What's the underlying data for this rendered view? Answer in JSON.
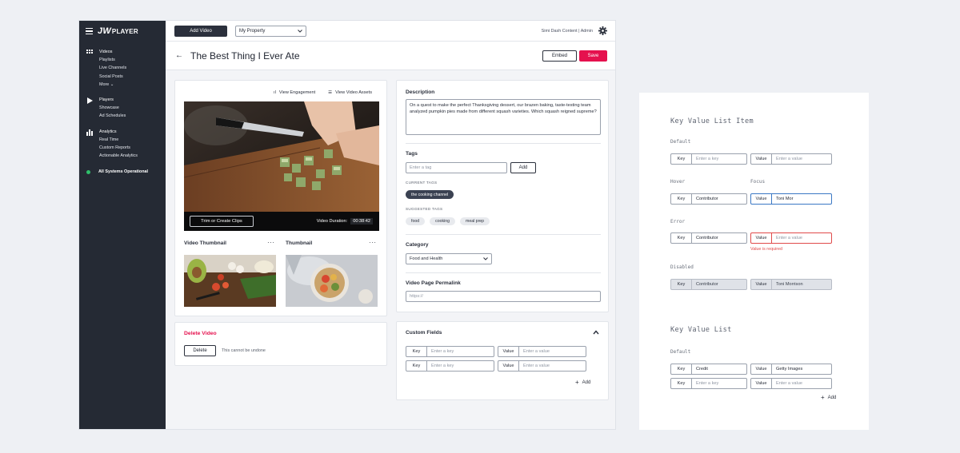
{
  "sidebar": {
    "logo": "PLAYER",
    "groups": [
      {
        "items": [
          "Videos",
          "Playlists",
          "Live Channels",
          "Social Posts",
          "More ⌄"
        ]
      },
      {
        "items": [
          "Players",
          "Showcase",
          "Ad Schedules"
        ]
      },
      {
        "items": [
          "Analytics",
          "Real Time",
          "Custom Reports",
          "Actionable Analytics"
        ]
      }
    ],
    "status": "All Systems Operational"
  },
  "topbar": {
    "add_video": "Add Video",
    "property": "My Property",
    "user": "Simi Dash Content | Admin"
  },
  "titlebar": {
    "title": "The Best Thing I Ever Ate",
    "embed": "Embed",
    "save": "Save"
  },
  "media": {
    "view_engagement": "View Engagement",
    "view_assets": "View Video Assets",
    "trim": "Trim or Create Clips",
    "duration_label": "Video Duration:",
    "duration_value": "00:38:42",
    "video_thumb_label": "Video Thumbnail",
    "thumb_label": "Thumbnail",
    "dots": "···"
  },
  "delete": {
    "title": "Delete Video",
    "button": "Delete",
    "note": "This cannot be undone"
  },
  "form": {
    "description_label": "Description",
    "description": "On a quest to make the perfect Thanksgiving dessert, our brazen baking, taste-testing team analyzed pumpkin pies made from different squash varieties. Which squash reigned supreme?",
    "tags_label": "Tags",
    "tag_placeholder": "Enter a tag",
    "add": "Add",
    "current_tags_label": "CURRENT TAGS",
    "current_tags": [
      "the cooking channel"
    ],
    "suggested_tags_label": "SUGGESTED TAGS",
    "suggested_tags": [
      "food",
      "cooking",
      "meal prep"
    ],
    "category_label": "Category",
    "category": "Food and Health",
    "permalink_label": "Video Page Permalink",
    "permalink_placeholder": "https://"
  },
  "custom_fields": {
    "title": "Custom Fields",
    "key_label": "Key",
    "value_label": "Value",
    "key_placeholder": "Enter a key",
    "value_placeholder": "Enter a value",
    "add": "Add"
  },
  "spec": {
    "item_title": "Key Value List Item",
    "default_label": "Default",
    "hover_label": "Hover",
    "focus_label": "Focus",
    "error_label": "Error",
    "disabled_label": "Disabled",
    "key_label": "Key",
    "value_label": "Value",
    "key_placeholder": "Enter a key",
    "value_placeholder": "Enter a value",
    "contributor": "Contributor",
    "focus_value": "Toni Mor",
    "error_msg": "Value is required",
    "disabled_value": "Toni Morrison",
    "list_title": "Key Value List",
    "list_default_label": "Default",
    "row1_key": "Credit",
    "row1_value": "Getty Images",
    "add": "Add"
  },
  "colors": {
    "sidebar": "#252a34",
    "accent": "#e5114e",
    "focus": "#3b78c4",
    "error": "#e04a4a",
    "status": "#2fbf6a"
  }
}
